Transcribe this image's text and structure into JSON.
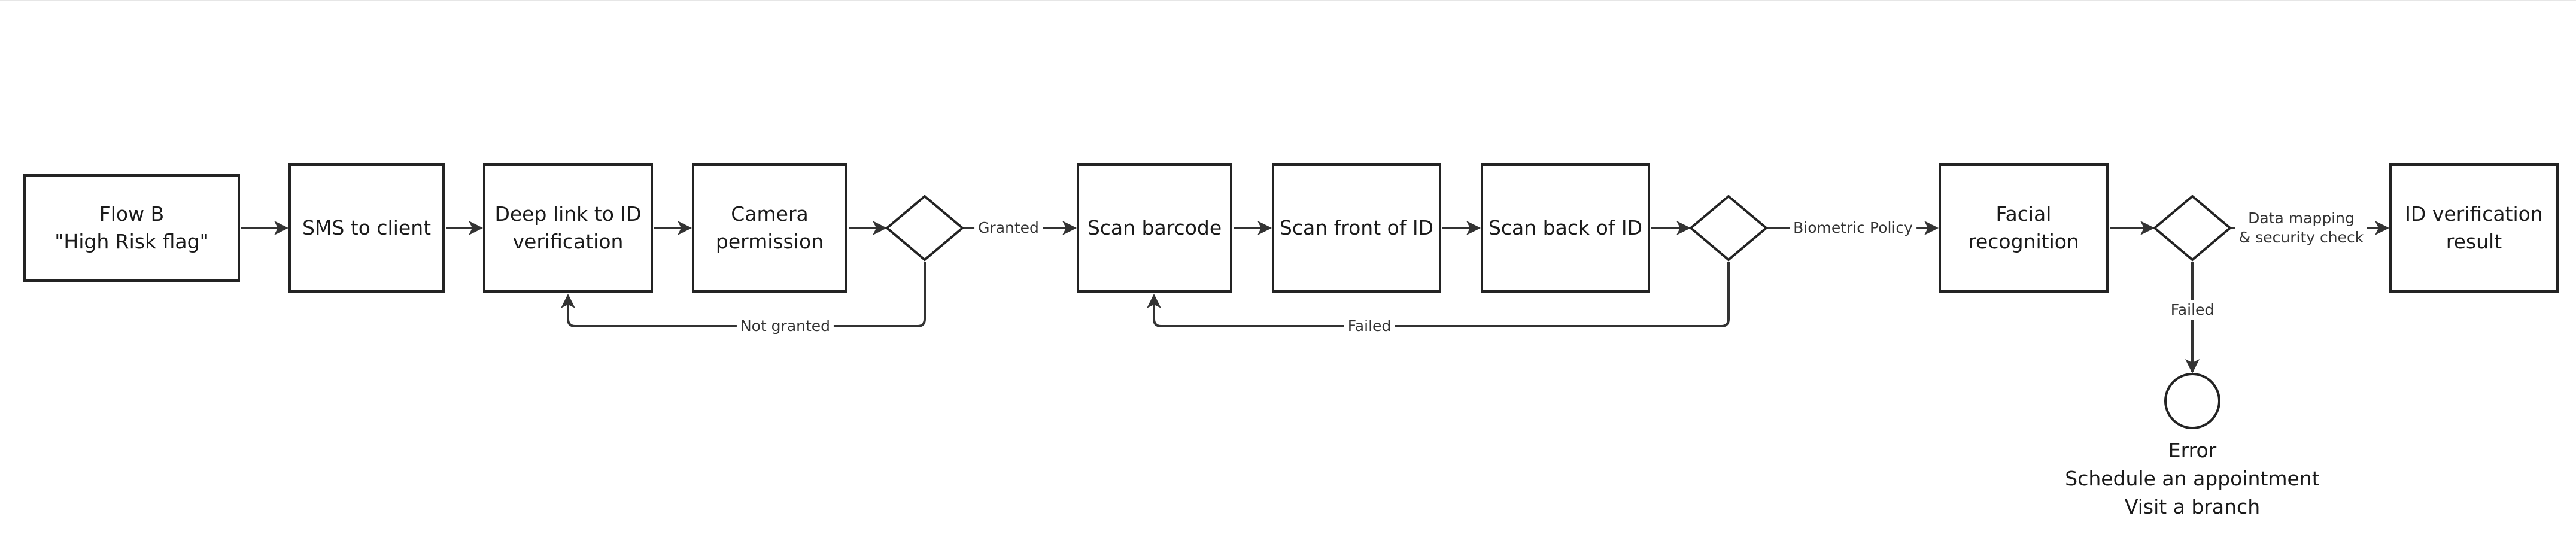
{
  "diagram": {
    "type": "flowchart",
    "nodes": [
      {
        "id": "flow_b",
        "shape": "rect",
        "label": "Flow B\n\"High Risk flag\""
      },
      {
        "id": "sms",
        "shape": "rect",
        "label": "SMS to client"
      },
      {
        "id": "deep_link",
        "shape": "rect",
        "label": "Deep link to ID\nverification"
      },
      {
        "id": "camera",
        "shape": "rect",
        "label": "Camera\npermission"
      },
      {
        "id": "decision_camera",
        "shape": "diamond",
        "label": ""
      },
      {
        "id": "scan_barcode",
        "shape": "rect",
        "label": "Scan barcode"
      },
      {
        "id": "scan_front",
        "shape": "rect",
        "label": "Scan front of ID"
      },
      {
        "id": "scan_back",
        "shape": "rect",
        "label": "Scan back of ID"
      },
      {
        "id": "decision_scan",
        "shape": "diamond",
        "label": ""
      },
      {
        "id": "facial",
        "shape": "rect",
        "label": "Facial\nrecognition"
      },
      {
        "id": "decision_facial",
        "shape": "diamond",
        "label": ""
      },
      {
        "id": "result",
        "shape": "rect",
        "label": "ID verification\nresult"
      },
      {
        "id": "error",
        "shape": "circle",
        "label": ""
      }
    ],
    "edges": [
      {
        "from": "flow_b",
        "to": "sms",
        "label": ""
      },
      {
        "from": "sms",
        "to": "deep_link",
        "label": ""
      },
      {
        "from": "deep_link",
        "to": "camera",
        "label": ""
      },
      {
        "from": "camera",
        "to": "decision_camera",
        "label": ""
      },
      {
        "from": "decision_camera",
        "to": "scan_barcode",
        "label": "Granted"
      },
      {
        "from": "decision_camera",
        "to": "deep_link",
        "label": "Not granted"
      },
      {
        "from": "scan_barcode",
        "to": "scan_front",
        "label": ""
      },
      {
        "from": "scan_front",
        "to": "scan_back",
        "label": ""
      },
      {
        "from": "scan_back",
        "to": "decision_scan",
        "label": ""
      },
      {
        "from": "decision_scan",
        "to": "facial",
        "label": "Biometric Policy"
      },
      {
        "from": "decision_scan",
        "to": "scan_barcode",
        "label": "Failed"
      },
      {
        "from": "facial",
        "to": "decision_facial",
        "label": ""
      },
      {
        "from": "decision_facial",
        "to": "result",
        "label": "Data mapping\n& security check"
      },
      {
        "from": "decision_facial",
        "to": "error",
        "label": "Failed"
      }
    ],
    "error_text": [
      "Error",
      "Schedule an appointment",
      "Visit a branch"
    ],
    "colors": {
      "stroke": "#232323",
      "text": "#1a1a1a",
      "label_text": "#333333",
      "background": "#ffffff"
    }
  }
}
